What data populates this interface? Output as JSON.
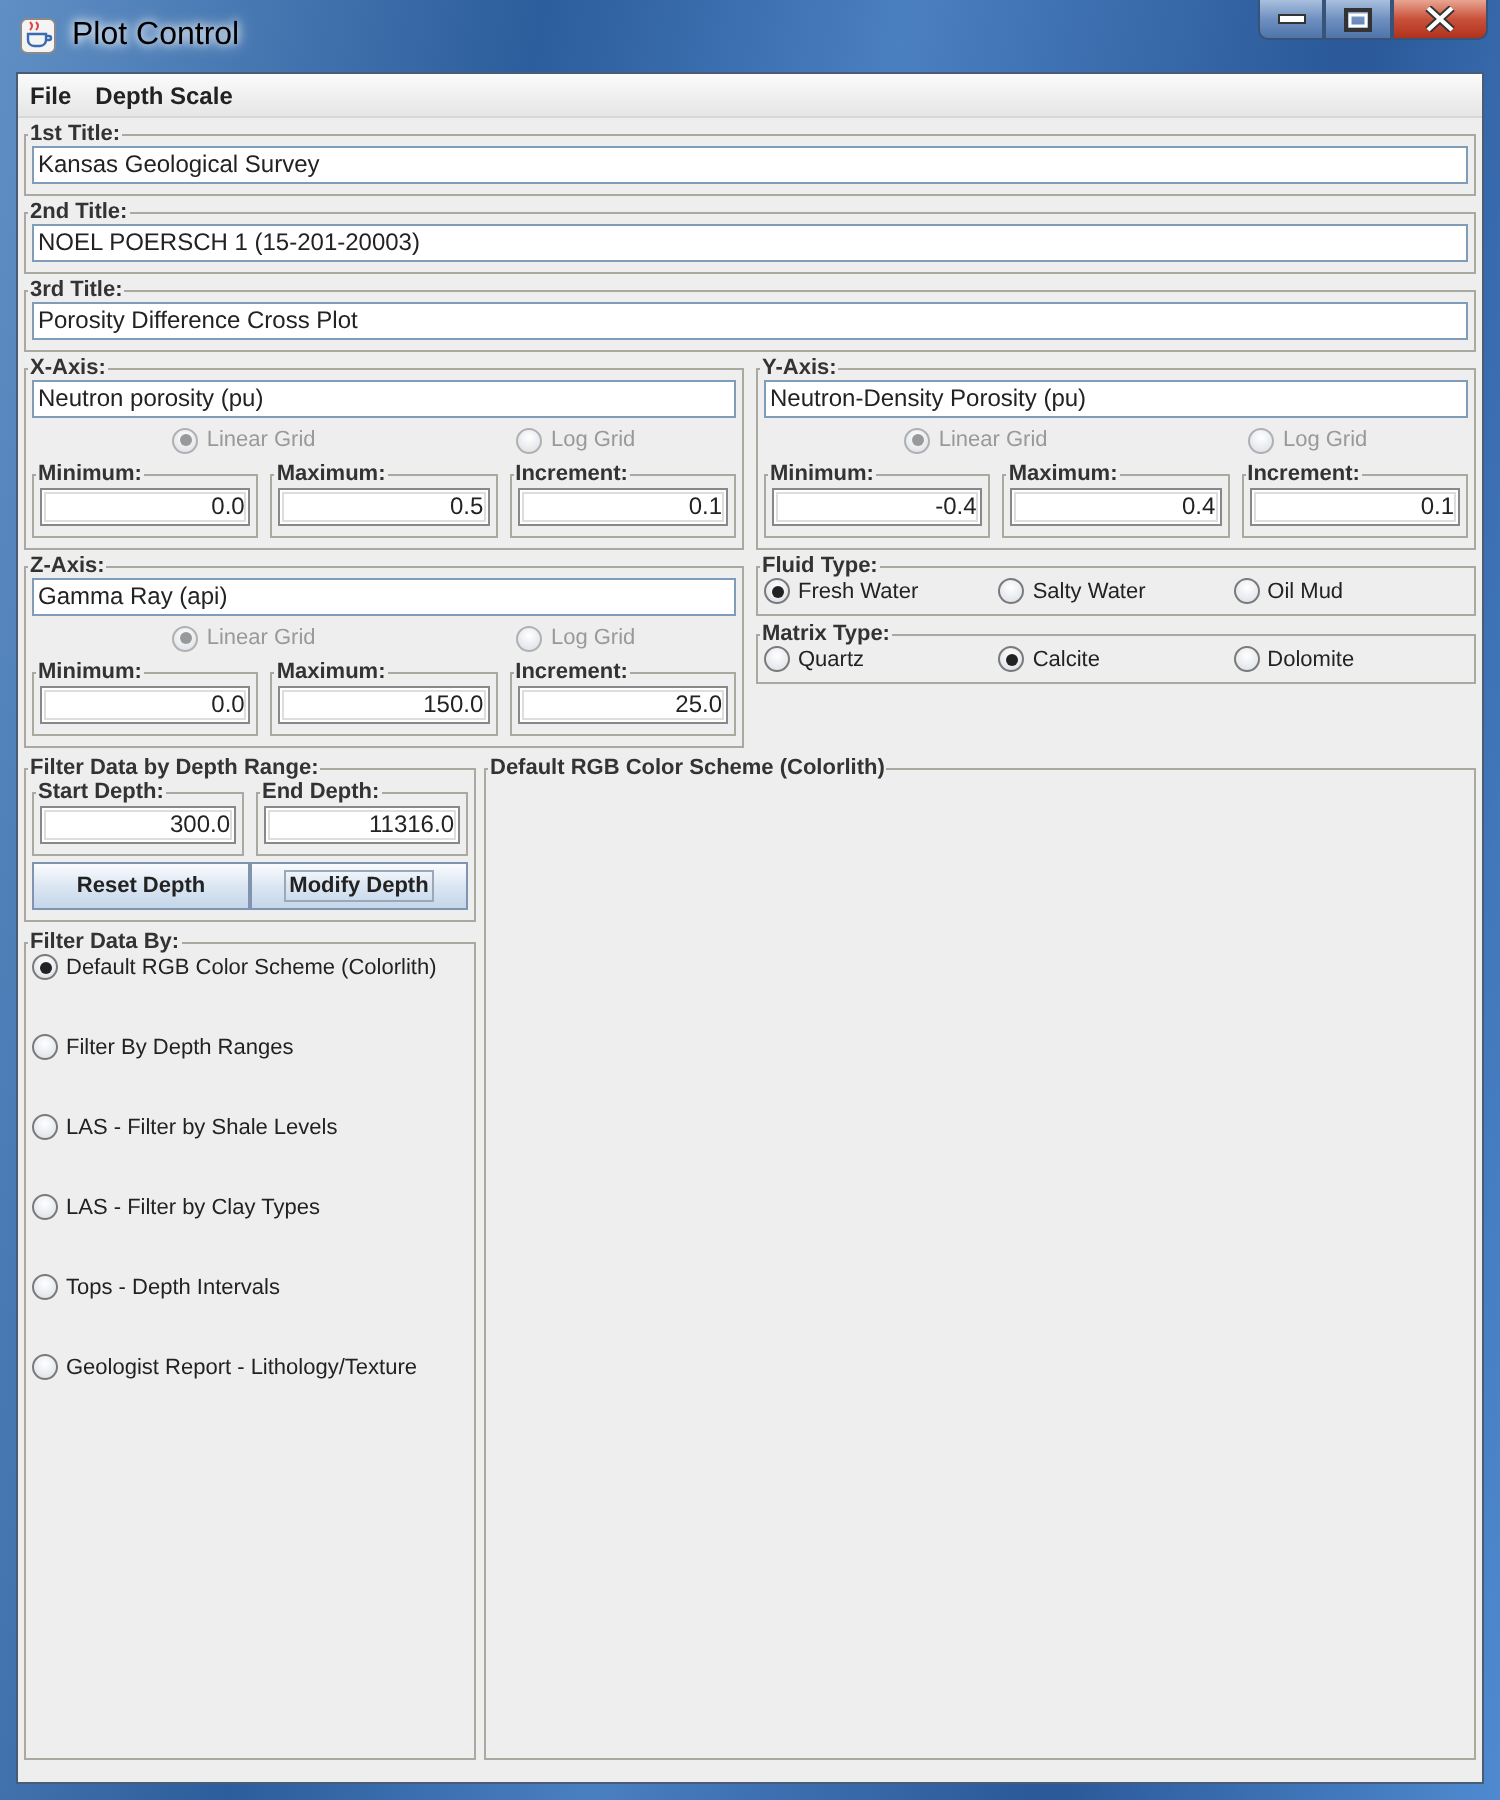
{
  "window": {
    "title": "Plot Control"
  },
  "menu": [
    {
      "label": "File"
    },
    {
      "label": "Depth Scale"
    }
  ],
  "titles": [
    {
      "label": "1st Title:",
      "value": "Kansas Geological Survey"
    },
    {
      "label": "2nd Title:",
      "value": "NOEL POERSCH 1 (15-201-20003)"
    },
    {
      "label": "3rd Title:",
      "value": "Porosity Difference Cross Plot"
    }
  ],
  "axes": [
    {
      "label": "X-Axis:",
      "value": "Neutron porosity (pu)",
      "grid_options": [
        {
          "label": "Linear Grid",
          "selected": true,
          "disabled": true
        },
        {
          "label": "Log Grid",
          "selected": false,
          "disabled": true
        }
      ],
      "fields": [
        {
          "label": "Minimum:",
          "value": "0.0"
        },
        {
          "label": "Maximum:",
          "value": "0.5"
        },
        {
          "label": "Increment:",
          "value": "0.1"
        }
      ]
    },
    {
      "label": "Y-Axis:",
      "value": "Neutron-Density Porosity (pu)",
      "grid_options": [
        {
          "label": "Linear Grid",
          "selected": true,
          "disabled": true
        },
        {
          "label": "Log Grid",
          "selected": false,
          "disabled": true
        }
      ],
      "fields": [
        {
          "label": "Minimum:",
          "value": "-0.4"
        },
        {
          "label": "Maximum:",
          "value": "0.4"
        },
        {
          "label": "Increment:",
          "value": "0.1"
        }
      ]
    },
    {
      "label": "Z-Axis:",
      "value": "Gamma Ray (api)",
      "grid_options": [
        {
          "label": "Linear Grid",
          "selected": true,
          "disabled": true
        },
        {
          "label": "Log Grid",
          "selected": false,
          "disabled": true
        }
      ],
      "fields": [
        {
          "label": "Minimum:",
          "value": "0.0"
        },
        {
          "label": "Maximum:",
          "value": "150.0"
        },
        {
          "label": "Increment:",
          "value": "25.0"
        }
      ]
    }
  ],
  "fluid_type": {
    "label": "Fluid Type:",
    "options": [
      {
        "label": "Fresh Water",
        "selected": true
      },
      {
        "label": "Salty Water",
        "selected": false
      },
      {
        "label": "Oil Mud",
        "selected": false
      }
    ]
  },
  "matrix_type": {
    "label": "Matrix Type:",
    "options": [
      {
        "label": "Quartz",
        "selected": false
      },
      {
        "label": "Calcite",
        "selected": true
      },
      {
        "label": "Dolomite",
        "selected": false
      }
    ]
  },
  "depth_range": {
    "label": "Filter Data by Depth Range:",
    "fields": [
      {
        "label": "Start Depth:",
        "value": "300.0"
      },
      {
        "label": "End Depth:",
        "value": "11316.0"
      }
    ],
    "buttons": [
      {
        "label": "Reset Depth",
        "focused": false
      },
      {
        "label": "Modify Depth",
        "focused": true
      }
    ]
  },
  "filter_by": {
    "label": "Filter Data By:",
    "options": [
      {
        "label": "Default RGB Color Scheme (Colorlith)",
        "selected": true
      },
      {
        "label": "Filter By Depth Ranges",
        "selected": false
      },
      {
        "label": "LAS - Filter by Shale Levels",
        "selected": false
      },
      {
        "label": "LAS - Filter by Clay Types",
        "selected": false
      },
      {
        "label": "Tops - Depth Intervals",
        "selected": false
      },
      {
        "label": "Geologist Report - Lithology/Texture",
        "selected": false
      }
    ]
  },
  "scheme_panel": {
    "label": "Default RGB Color Scheme (Colorlith)"
  }
}
